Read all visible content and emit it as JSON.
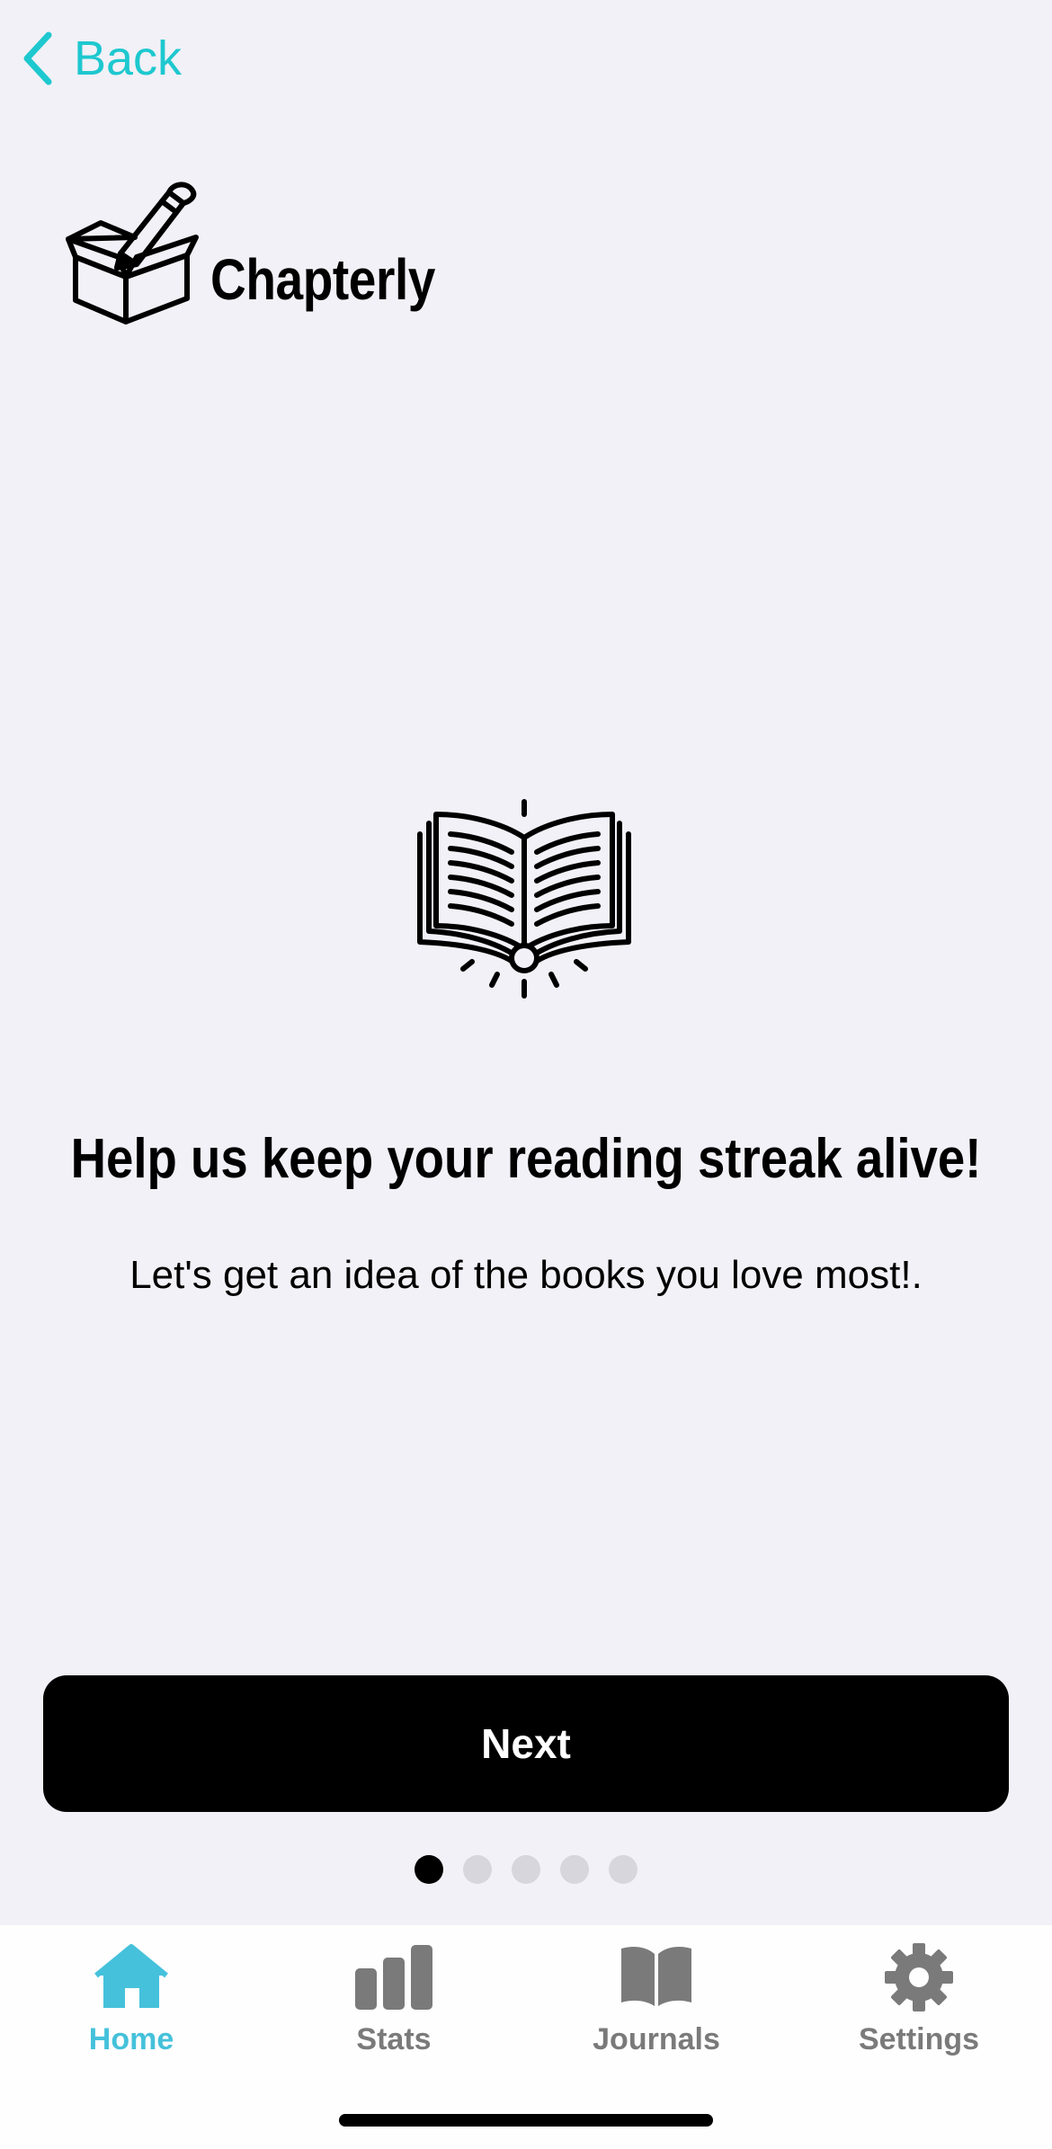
{
  "nav": {
    "back_label": "Back"
  },
  "app": {
    "name": "Chapterly"
  },
  "onboarding": {
    "headline": "Help us keep your reading streak alive!",
    "subline": "Let's get an idea of the books you love most!.",
    "next_label": "Next",
    "pages_total": 5,
    "current_page": 1
  },
  "tabs": [
    {
      "label": "Home",
      "icon": "home-icon",
      "active": true
    },
    {
      "label": "Stats",
      "icon": "stats-icon",
      "active": false
    },
    {
      "label": "Journals",
      "icon": "journal-book-icon",
      "active": false
    },
    {
      "label": "Settings",
      "icon": "gear-icon",
      "active": false
    }
  ],
  "colors": {
    "accent": "#1ec8cf",
    "tab_active": "#45c1db",
    "tab_inactive": "#7a7a7a",
    "background": "#f2f1f7",
    "button": "#000000"
  }
}
